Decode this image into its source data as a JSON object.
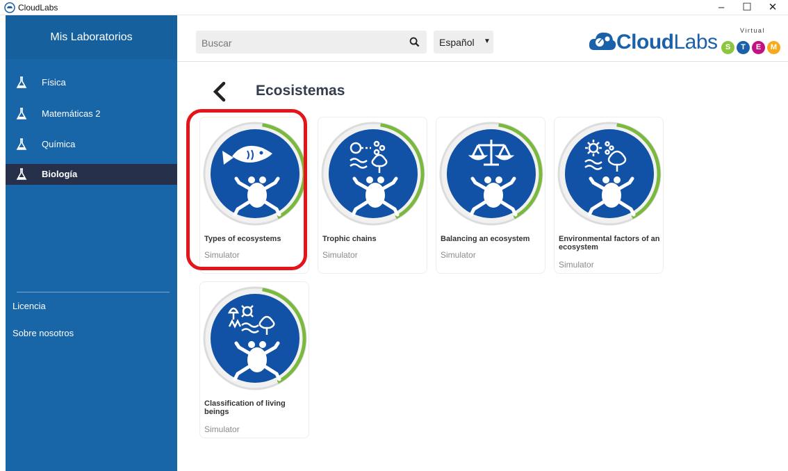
{
  "window": {
    "title": "CloudLabs",
    "controls": {
      "minimize": "–",
      "maximize": "☐",
      "close": "✕"
    }
  },
  "sidebar": {
    "header": "Mis Laboratorios",
    "items": [
      {
        "label": "Física",
        "icon": "flask-icon",
        "active": false
      },
      {
        "label": "Matemáticas 2",
        "icon": "flask-icon",
        "active": false
      },
      {
        "label": "Química",
        "icon": "flask-icon",
        "active": false
      },
      {
        "label": "Biología",
        "icon": "flask-icon",
        "active": true
      }
    ],
    "links": [
      {
        "label": "Licencia"
      },
      {
        "label": "Sobre nosotros"
      }
    ]
  },
  "topbar": {
    "search_placeholder": "Buscar",
    "language": "Español"
  },
  "logo": {
    "brand_bold": "Cloud",
    "brand_light": "Labs",
    "virtual": "Virtual",
    "stem": [
      {
        "letter": "S",
        "color": "#8cc63f"
      },
      {
        "letter": "T",
        "color": "#1b61a9"
      },
      {
        "letter": "E",
        "color": "#c2127f"
      },
      {
        "letter": "M",
        "color": "#f7a81b"
      }
    ]
  },
  "page": {
    "title": "Ecosistemas",
    "cards": [
      {
        "title": "Types of ecosystems",
        "type": "Simulator",
        "progress": 0.4,
        "icon": "fish-icon",
        "selected": true
      },
      {
        "title": "Trophic chains",
        "type": "Simulator",
        "progress": 0.4,
        "icon": "food-chain-icon",
        "selected": false
      },
      {
        "title": "Balancing an ecosystem",
        "type": "Simulator",
        "progress": 0.4,
        "icon": "scale-icon",
        "selected": false
      },
      {
        "title": "Environmental factors of an ecosystem",
        "type": "Simulator",
        "progress": 0.4,
        "icon": "environment-icon",
        "selected": false
      },
      {
        "title": "Classification of living beings",
        "type": "Simulator",
        "progress": 0.4,
        "icon": "living-beings-icon",
        "selected": false
      }
    ]
  },
  "colors": {
    "sidebar": "#1866a8",
    "active_item": "#27304a",
    "circle": "#1252a6",
    "progress_arc": "#7ab83e",
    "highlight": "#e3141a"
  }
}
